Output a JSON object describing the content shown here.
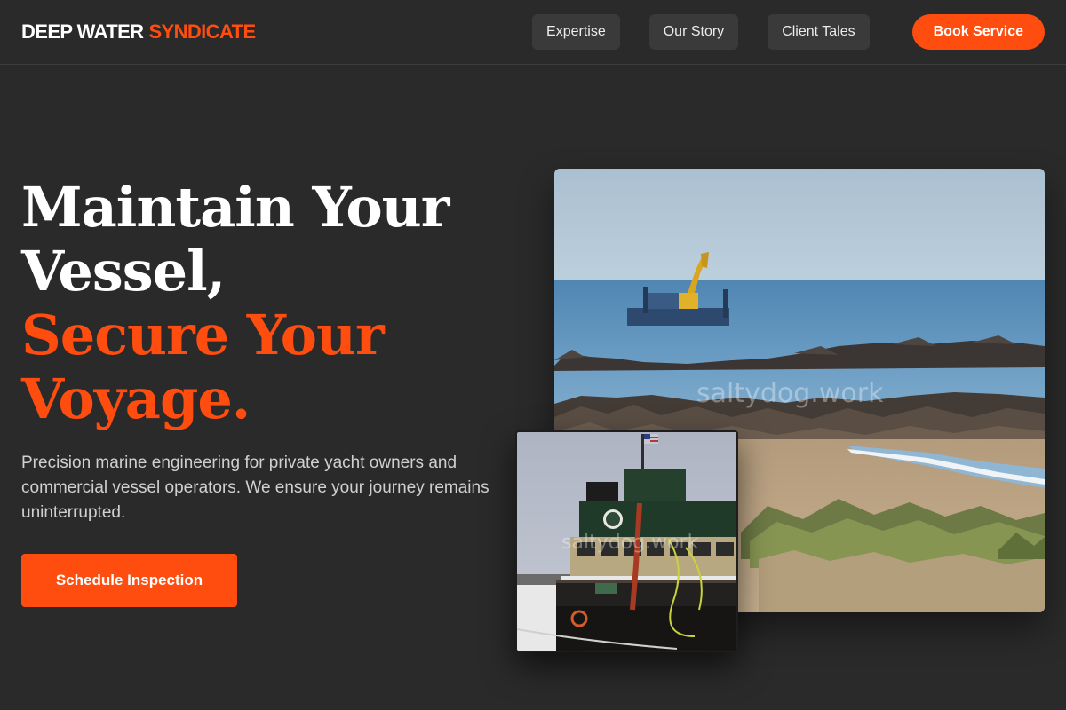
{
  "header": {
    "brand_part1": "DEEP WATER",
    "brand_part2": "SYNDICATE",
    "nav": [
      {
        "label": "Expertise"
      },
      {
        "label": "Our Story"
      },
      {
        "label": "Client Tales"
      }
    ],
    "cta_label": "Book Service"
  },
  "hero": {
    "title_line1": "Maintain Your",
    "title_line2": "Vessel,",
    "title_line3": "Secure Your",
    "title_line4": "Voyage.",
    "description": "Precision marine engineering for private yacht owners and commercial vessel operators. We ensure your journey remains uninterrupted.",
    "cta_label": "Schedule Inspection"
  },
  "images": {
    "large_watermark": "saltydog.work",
    "small_watermark": "saltydog.work"
  },
  "colors": {
    "background": "#2a2a2a",
    "accent": "#ff4d0f",
    "nav_button": "#3a3a3a"
  }
}
